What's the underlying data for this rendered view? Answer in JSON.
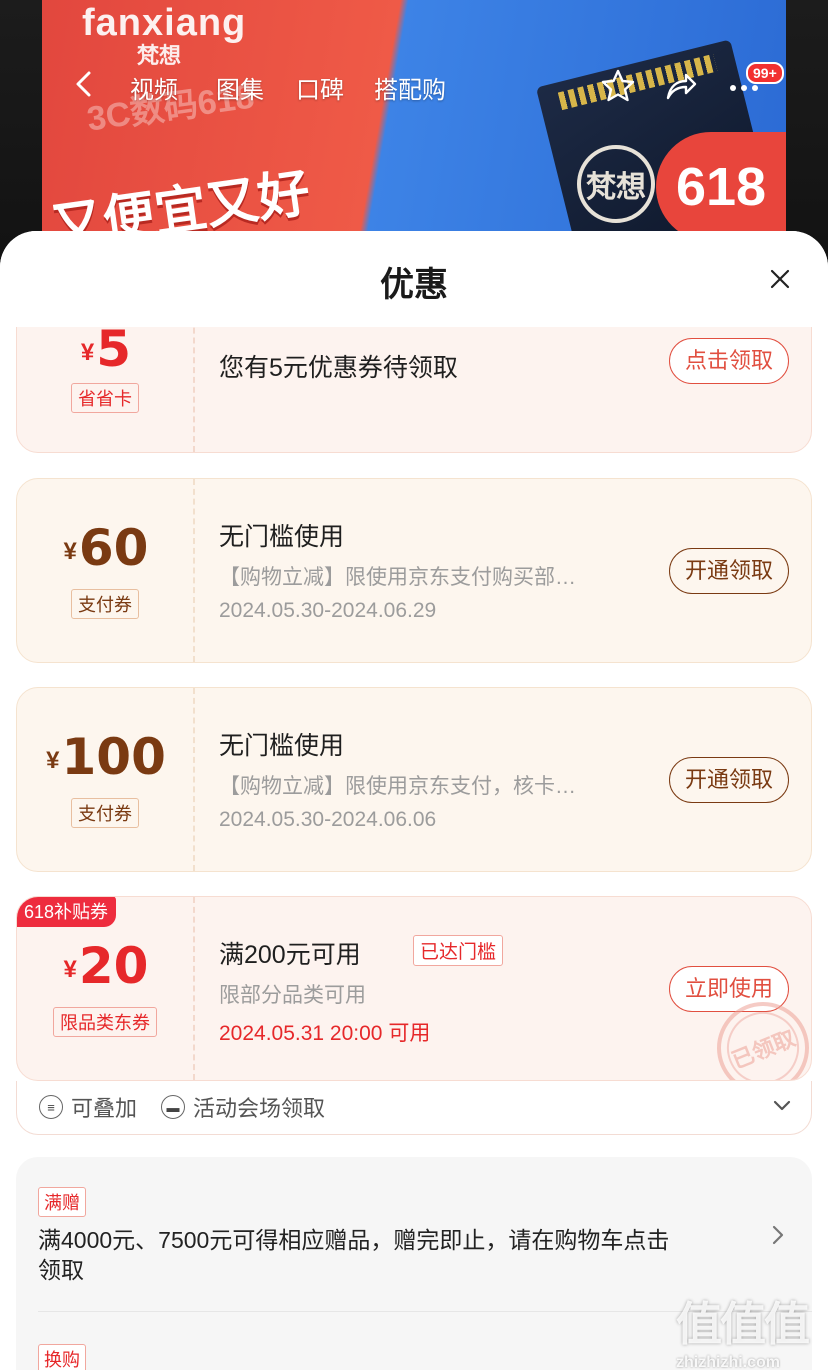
{
  "banner": {
    "brand": "fanxiang",
    "brand_sub": "梵想",
    "promo_line": "3C数码618",
    "slogan": "又便宜又好",
    "badge_618": "618",
    "seal_text": "梵想"
  },
  "topnav": {
    "tabs": [
      "视频",
      "图集",
      "口碑",
      "搭配购"
    ],
    "badge": "99+"
  },
  "sheet": {
    "title": "优惠"
  },
  "coupons": [
    {
      "currency": "¥",
      "amount": "5",
      "type_tag": "省省卡",
      "title": "您有5元优惠券待领取",
      "action": "点击领取"
    },
    {
      "currency": "¥",
      "amount": "60",
      "type_tag": "支付券",
      "title": "无门槛使用",
      "desc": "【购物立减】限使用京东支付购买部…",
      "date": "2024.05.30-2024.06.29",
      "action": "开通领取"
    },
    {
      "currency": "¥",
      "amount": "100",
      "type_tag": "支付券",
      "title": "无门槛使用",
      "desc": "【购物立减】限使用京东支付，核卡…",
      "date": "2024.05.30-2024.06.06",
      "action": "开通领取"
    },
    {
      "corner_tag": "618补贴券",
      "currency": "¥",
      "amount": "20",
      "type_tag": "限品类东券",
      "title": "满200元可用",
      "reached": "已达门槛",
      "desc": "限部分品类可用",
      "date": "2024.05.31 20:00 可用",
      "action": "立即使用",
      "stamp": "已领取"
    }
  ],
  "stack_bar": {
    "stackable": "可叠加",
    "venue": "活动会场领取"
  },
  "gift": {
    "tag": "满赠",
    "text": "满4000元、7500元可得相应赠品，赠完即止，请在购物车点击领取"
  },
  "exchange": {
    "tag": "换购"
  },
  "watermark": {
    "chars": "值值值",
    "url": "zhizhizhi.com"
  },
  "colors": {
    "accent_red": "#e6282a",
    "brown": "#7a3a12",
    "coupon_pink_bg": "#fdf3ef",
    "coupon_beige_bg": "#fdf6ee"
  }
}
